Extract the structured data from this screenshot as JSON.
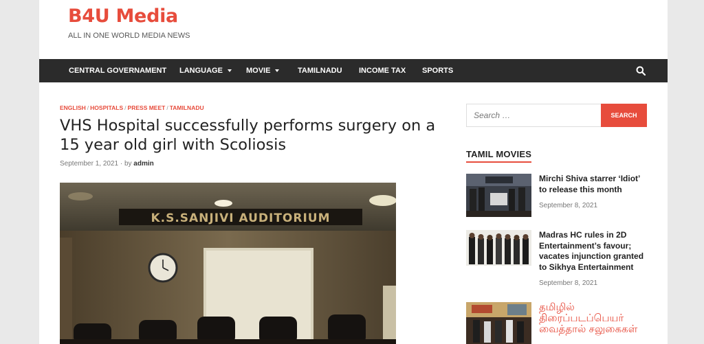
{
  "site": {
    "title": "B4U Media",
    "tagline": "ALL IN ONE WORLD MEDIA NEWS"
  },
  "nav": {
    "items": [
      {
        "label": "CENTRAL GOVERNAMENT",
        "dropdown": false
      },
      {
        "label": "LANGUAGE",
        "dropdown": true
      },
      {
        "label": "MOVIE",
        "dropdown": true
      },
      {
        "label": "TAMILNADU",
        "dropdown": false
      },
      {
        "label": "INCOME TAX",
        "dropdown": false
      },
      {
        "label": "SPORTS",
        "dropdown": false
      }
    ],
    "search_icon": "search-icon"
  },
  "article": {
    "categories": [
      "ENGLISH",
      "HOSPITALS",
      "PRESS MEET",
      "TAMILNADU"
    ],
    "title": "VHS Hospital successfully performs surgery on a 15 year old girl with Scoliosis",
    "date": "September 1, 2021",
    "by": "· by",
    "author": "admin",
    "image_sign_text": "K.S.SANJIVI AUDITORIUM"
  },
  "sidebar": {
    "search_placeholder": "Search …",
    "search_button": "SEARCH",
    "widget_title": "TAMIL MOVIES",
    "posts": [
      {
        "title": "Mirchi Shiva starrer ‘Idiot’ to release this month",
        "date": "September 8, 2021"
      },
      {
        "title": "Madras HC rules in 2D Entertainment’s favour; vacates injunction granted to Sikhya Entertainment",
        "date": "September 8, 2021"
      },
      {
        "title": "தமிழில் திரைப்படப்பெயர் வைத்தால் சலுகைகள்",
        "date": ""
      }
    ]
  },
  "colors": {
    "accent": "#e74c3c",
    "nav_bg": "#2b2b2b",
    "page_bg": "#e9e9e9"
  }
}
